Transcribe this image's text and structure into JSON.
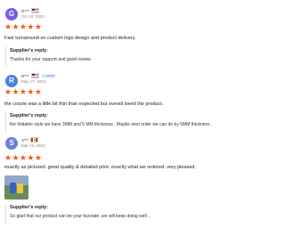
{
  "reviews": [
    {
      "avatar_letter": "G",
      "avatar_color": "#7a5ee0",
      "name": "G***",
      "country_flag": "us-flag-icon",
      "date": "Oct 14, 2023",
      "rating": 5,
      "stars": "★★★★★",
      "text": "Fast turnaround on custom logo design and product delivery.",
      "reply_title": "Supplier's reply:",
      "reply_text": "Thanks for your support and good review"
    },
    {
      "avatar_letter": "R",
      "avatar_color": "#4d7ee0",
      "name": "R***",
      "country_flag": "us-flag-icon",
      "badge": "Verified",
      "date": "May 17, 2023",
      "rating": 5,
      "stars": "★★★★★",
      "text": "the coozie was a little bit thin than expected but overall loved the product.",
      "reply_title": "Supplier's reply:",
      "reply_text": "the foldable style we have 3MM and 5 MM thickness , Maybe next order we can do by 5MM thicknexx ."
    },
    {
      "avatar_letter": "S",
      "avatar_color": "#6f7fd8",
      "name": "S***",
      "country_flag": "ca-flag-icon",
      "date": "Mar 15, 2023",
      "rating": 5,
      "stars": "★★★★★",
      "text": "exactly as pictured. great quality & detailed print. exactly what we ordered. very pleased.",
      "reply_title": "Supplier's reply:",
      "reply_text": "So glad that our product can be your favorate ,we will keep doing well .."
    }
  ],
  "colors": {
    "star": "#f05a1a",
    "text": "#222222",
    "muted": "#888888"
  }
}
